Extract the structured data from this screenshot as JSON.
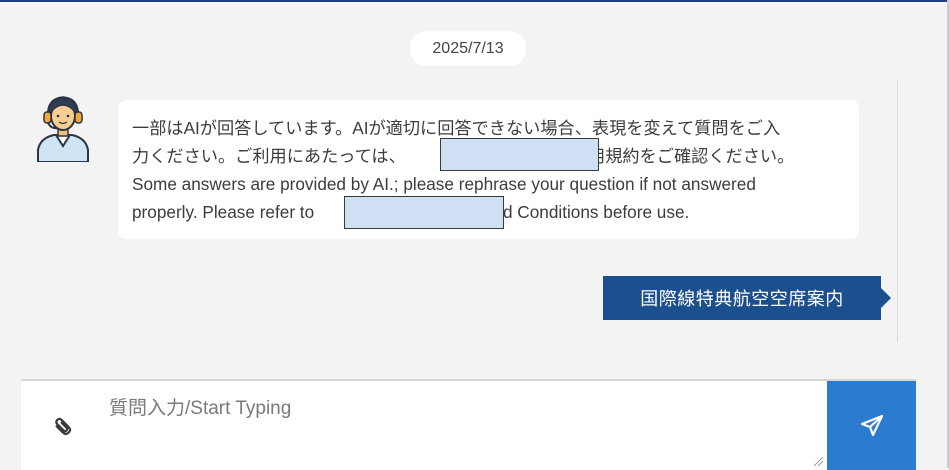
{
  "chat": {
    "date": "2025/7/13",
    "bot_message": {
      "line1": "一部はAIが回答しています。AIが適切に回答できない場合、表現を変えて質問をご入",
      "line2": "力ください。ご利用にあたっては、",
      "line2_tail": "利用規約をご確認ください。",
      "line3": "Some answers are provided by AI.; please rephrase your question if not answered",
      "line4": "properly. Please refer to",
      "line4_tail": "ms and Conditions before use."
    },
    "user_message": "国際線特典航空空席案内"
  },
  "composer": {
    "placeholder": "質問入力/Start Typing",
    "attach_icon": "paperclip-icon",
    "send_icon": "paper-plane-icon"
  },
  "colors": {
    "accent": "#1b4f8e",
    "send": "#2b7bd0",
    "redaction": "#cfe0f5"
  }
}
